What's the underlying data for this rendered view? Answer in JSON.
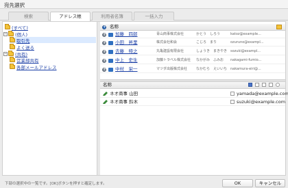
{
  "window": {
    "title": "宛先選択"
  },
  "tabs": [
    {
      "label": "検索",
      "active": false
    },
    {
      "label": "アドレス帳",
      "active": true
    },
    {
      "label": "利用者名簿",
      "active": false
    },
    {
      "label": "一括入力",
      "active": false
    }
  ],
  "tree": [
    {
      "label": "(すべて)",
      "level": 0,
      "expander": "",
      "selected": false
    },
    {
      "label": "(個人)",
      "level": 0,
      "expander": "−",
      "selected": false
    },
    {
      "label": "取引先",
      "level": 1,
      "expander": "",
      "selected": true
    },
    {
      "label": "よく送る",
      "level": 1,
      "expander": "",
      "selected": false
    },
    {
      "label": "(共有)",
      "level": 0,
      "expander": "−",
      "selected": false
    },
    {
      "label": "営業部共有",
      "level": 1,
      "expander": "",
      "selected": false
    },
    {
      "label": "各部メールアドレス",
      "level": 1,
      "expander": "",
      "selected": false
    }
  ],
  "upper": {
    "column_header": "名称",
    "rows": [
      {
        "name": "加藤　四郎",
        "company": "青山商事株式会社",
        "kana": "かとう　しろう",
        "email": "katoz@example..."
      },
      {
        "name": "小田　昇里",
        "company": "株式会社和会",
        "kana": "こじろ　まり",
        "email": "ozuruno@exampl..."
      },
      {
        "name": "去藤　特之",
        "company": "丸亀建設有限会社",
        "kana": "しょうき　まきやき",
        "email": "sozuki@exampl..."
      },
      {
        "name": "中上　史生",
        "company": "加藤トラベル株式会社",
        "kana": "なかがみ　ふみお",
        "email": "nakagami-fumio..."
      },
      {
        "name": "中村　栄一",
        "company": "マツダ出版株式会社",
        "kana": "なかむら　えいいち",
        "email": "nakamura-eiri@..."
      }
    ]
  },
  "lower": {
    "column_header": "名称",
    "rows": [
      {
        "name": "ネオ商事 山田",
        "email": "yamada@example.com"
      },
      {
        "name": "ネオ商事 鈴木",
        "email": "suzuki@example.com"
      }
    ]
  },
  "footer": {
    "message": "下部の選択中の一覧です。[OK]ボタンを押すと確定します。",
    "ok_label": "OK",
    "cancel_label": "キャンセル"
  },
  "colors": {
    "link": "#1b3fa6",
    "selected_row": "#dbeaff",
    "folder": "#f3c33a"
  }
}
